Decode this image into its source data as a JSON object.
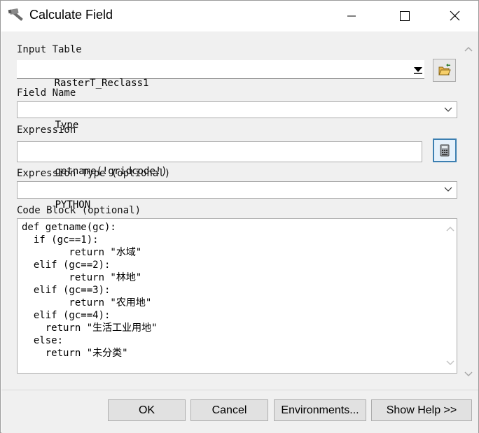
{
  "window": {
    "title": "Calculate Field",
    "icon": "hammer-icon",
    "controls": [
      "minimize-icon",
      "maximize-icon",
      "close-icon"
    ]
  },
  "form": {
    "input_table": {
      "label": "Input Table",
      "value": "RasterT_Reclass1",
      "browse_icon": "folder-open-icon"
    },
    "field_name": {
      "label": "Field Name",
      "value": "Type"
    },
    "expression": {
      "label": "Expression",
      "value": "getname(!gridcode!)",
      "builder_icon": "calculator-icon"
    },
    "expression_type": {
      "label": "Expression Type (optional)",
      "value": "PYTHON"
    },
    "code_block": {
      "label": "Code Block (optional)",
      "lines": [
        "def getname(gc):",
        "  if (gc==1):",
        "        return \"水域\"",
        "  elif (gc==2):",
        "        return \"林地\"",
        "  elif (gc==3):",
        "        return \"农用地\"",
        "  elif (gc==4):",
        "    return \"生活工业用地\"",
        "  else:",
        "    return \"未分类\""
      ]
    }
  },
  "buttons": {
    "ok": "OK",
    "cancel": "Cancel",
    "environments": "Environments...",
    "show_help": "Show Help >>"
  },
  "colors": {
    "panel": "#f0f0f0",
    "focus_border": "#3c7fb1",
    "button_face": "#e1e1e1"
  }
}
